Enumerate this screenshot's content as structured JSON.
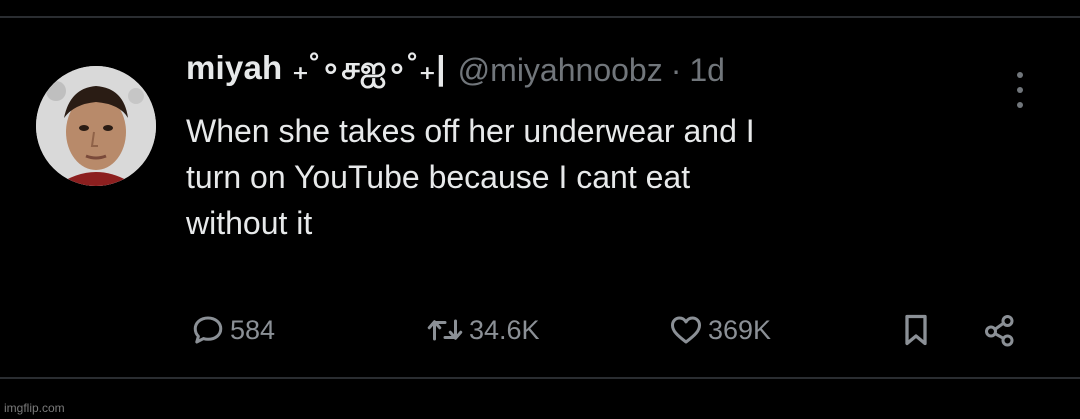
{
  "tweet": {
    "display_name": "miyah ₊˚∘சஐ∘˚₊|",
    "handle": "@miyahnoobz",
    "separator": "·",
    "time": "1d",
    "text": "When she takes off her underwear and I\nturn on YouTube because I cant eat\nwithout it",
    "actions": {
      "replies": "584",
      "retweets": "34.6K",
      "likes": "369K"
    },
    "icons": {
      "more": "more-vertical-icon",
      "reply": "comment-bubble-icon",
      "retweet": "retweet-icon",
      "like": "heart-icon",
      "bookmark": "bookmark-icon",
      "share": "share-icon"
    }
  },
  "watermark": "imgflip.com",
  "colors": {
    "background": "#000000",
    "text": "#e7e9ea",
    "muted": "#71767b",
    "divider": "#2a2d31"
  }
}
